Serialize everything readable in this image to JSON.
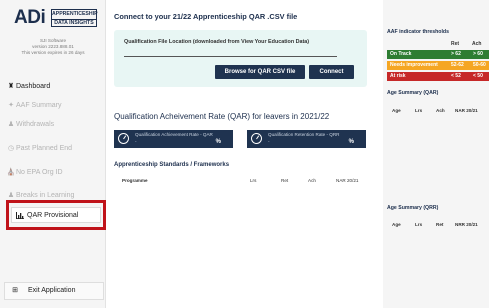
{
  "sidebar": {
    "logo": {
      "main": "ADi",
      "line1": "APPRENTICESHIP",
      "line2": "DATA INSIGHTS"
    },
    "version": {
      "line1": "SJI Software",
      "line2": "version 2223.888.01",
      "line3": "This version expires in 26 days"
    },
    "items": [
      {
        "label": "Dashboard",
        "icon": "home-icon",
        "state": "active"
      },
      {
        "label": "AAF Summary",
        "icon": "sparkle-icon",
        "state": "disabled"
      },
      {
        "label": "Withdrawals",
        "icon": "user-minus-icon",
        "state": "disabled"
      },
      {
        "label": "Past Planned End",
        "icon": "clock-icon",
        "state": "disabled"
      },
      {
        "label": "No EPA Org ID",
        "icon": "bank-icon",
        "state": "disabled"
      },
      {
        "label": "Breaks in Learning",
        "icon": "users-icon",
        "state": "disabled"
      },
      {
        "label": "QAR Provisional",
        "icon": "bar-chart-icon",
        "state": "selected"
      }
    ],
    "exit_label": "Exit Application",
    "exit_icon": "exit-icon"
  },
  "main": {
    "title": "Connect to your 21/22 Apprenticeship QAR .CSV file",
    "file_label": "Qualification File Location (downloaded from View Your Education Data)",
    "file_value": "",
    "browse_label": "Browse for QAR CSV file",
    "connect_label": "Connect",
    "qar_title": "Qualification Acheivement Rate (QAR) for  leavers in 2021/22",
    "cards": [
      {
        "label": "Qualification Achievement Rate - QAR",
        "dash": "-",
        "suffix": "%"
      },
      {
        "label": "Qualification Retention Rate - QRR",
        "dash": "-",
        "suffix": "%"
      }
    ],
    "standards_title": "Apprenticeship Standards / Frameworks",
    "standards_columns": [
      "Programme",
      "Lrs",
      "Ret",
      "Ach",
      "NAR 20/21"
    ]
  },
  "right": {
    "thresholds_title": "AAF indicator thresholds",
    "thresholds_columns": [
      "Ret",
      "Ach"
    ],
    "thresholds": [
      {
        "label": "On Track",
        "ret": "> 62",
        "ach": "> 60",
        "color": "#2e7d32"
      },
      {
        "label": "Needs improvement",
        "ret": "52-62",
        "ach": "50-60",
        "color": "#f5a623"
      },
      {
        "label": "At risk",
        "ret": "< 52",
        "ach": "< 50",
        "color": "#c62828"
      }
    ],
    "age_qar_title": "Age Summary (QAR)",
    "age_qar_columns": [
      "Age",
      "Lrs",
      "Ach",
      "NAR 20/21"
    ],
    "age_qrr_title": "Age Summary (QRR)",
    "age_qrr_columns": [
      "Age",
      "Lrs",
      "Ret",
      "NRR 20/21"
    ]
  },
  "colors": {
    "navy": "#1f3350",
    "panel": "#e8f6f4",
    "highlight": "#c0131a"
  }
}
